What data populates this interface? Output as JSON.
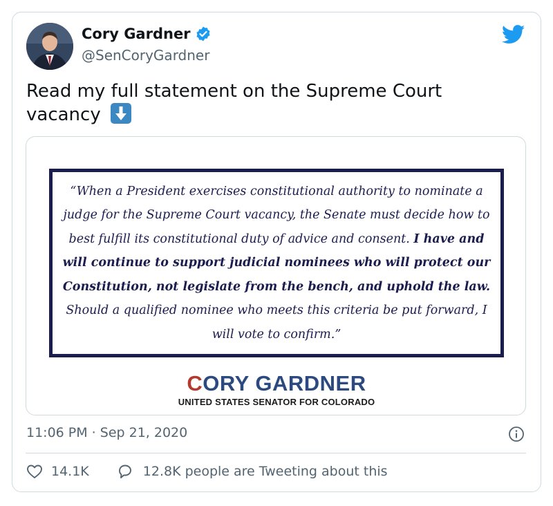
{
  "author": {
    "display_name": "Cory Gardner",
    "handle": "@SenCoryGardner",
    "verified": true
  },
  "tweet": {
    "text": "Read my full statement on the Supreme Court vacancy",
    "emoji": "down-arrow-emoji"
  },
  "media": {
    "quote_part1": "“When a President exercises constitutional authority to nominate a judge for the Supreme Court vacancy, the Senate must decide how to best fulfill its constitutional duty of advice and consent. ",
    "quote_bold": "I have and will continue to support judicial nominees who will protect our Constitution, not legislate from the bench, and uphold the law.",
    "quote_part2": " Should a qualified nominee who meets this criteria be put forward, I will vote to confirm.”",
    "brand_first_letter": "C",
    "brand_rest": "ORY GARDNER",
    "subtitle": "UNITED STATES SENATOR FOR COLORADO"
  },
  "timestamp": "11:06 PM · Sep 21, 2020",
  "stats": {
    "likes": "14.1K",
    "tweeting": "12.8K people are Tweeting about this"
  },
  "colors": {
    "twitter_blue": "#1d9bf0",
    "navy": "#1c1d4f",
    "brand_blue": "#2d4a80",
    "brand_red": "#b33a2f"
  }
}
